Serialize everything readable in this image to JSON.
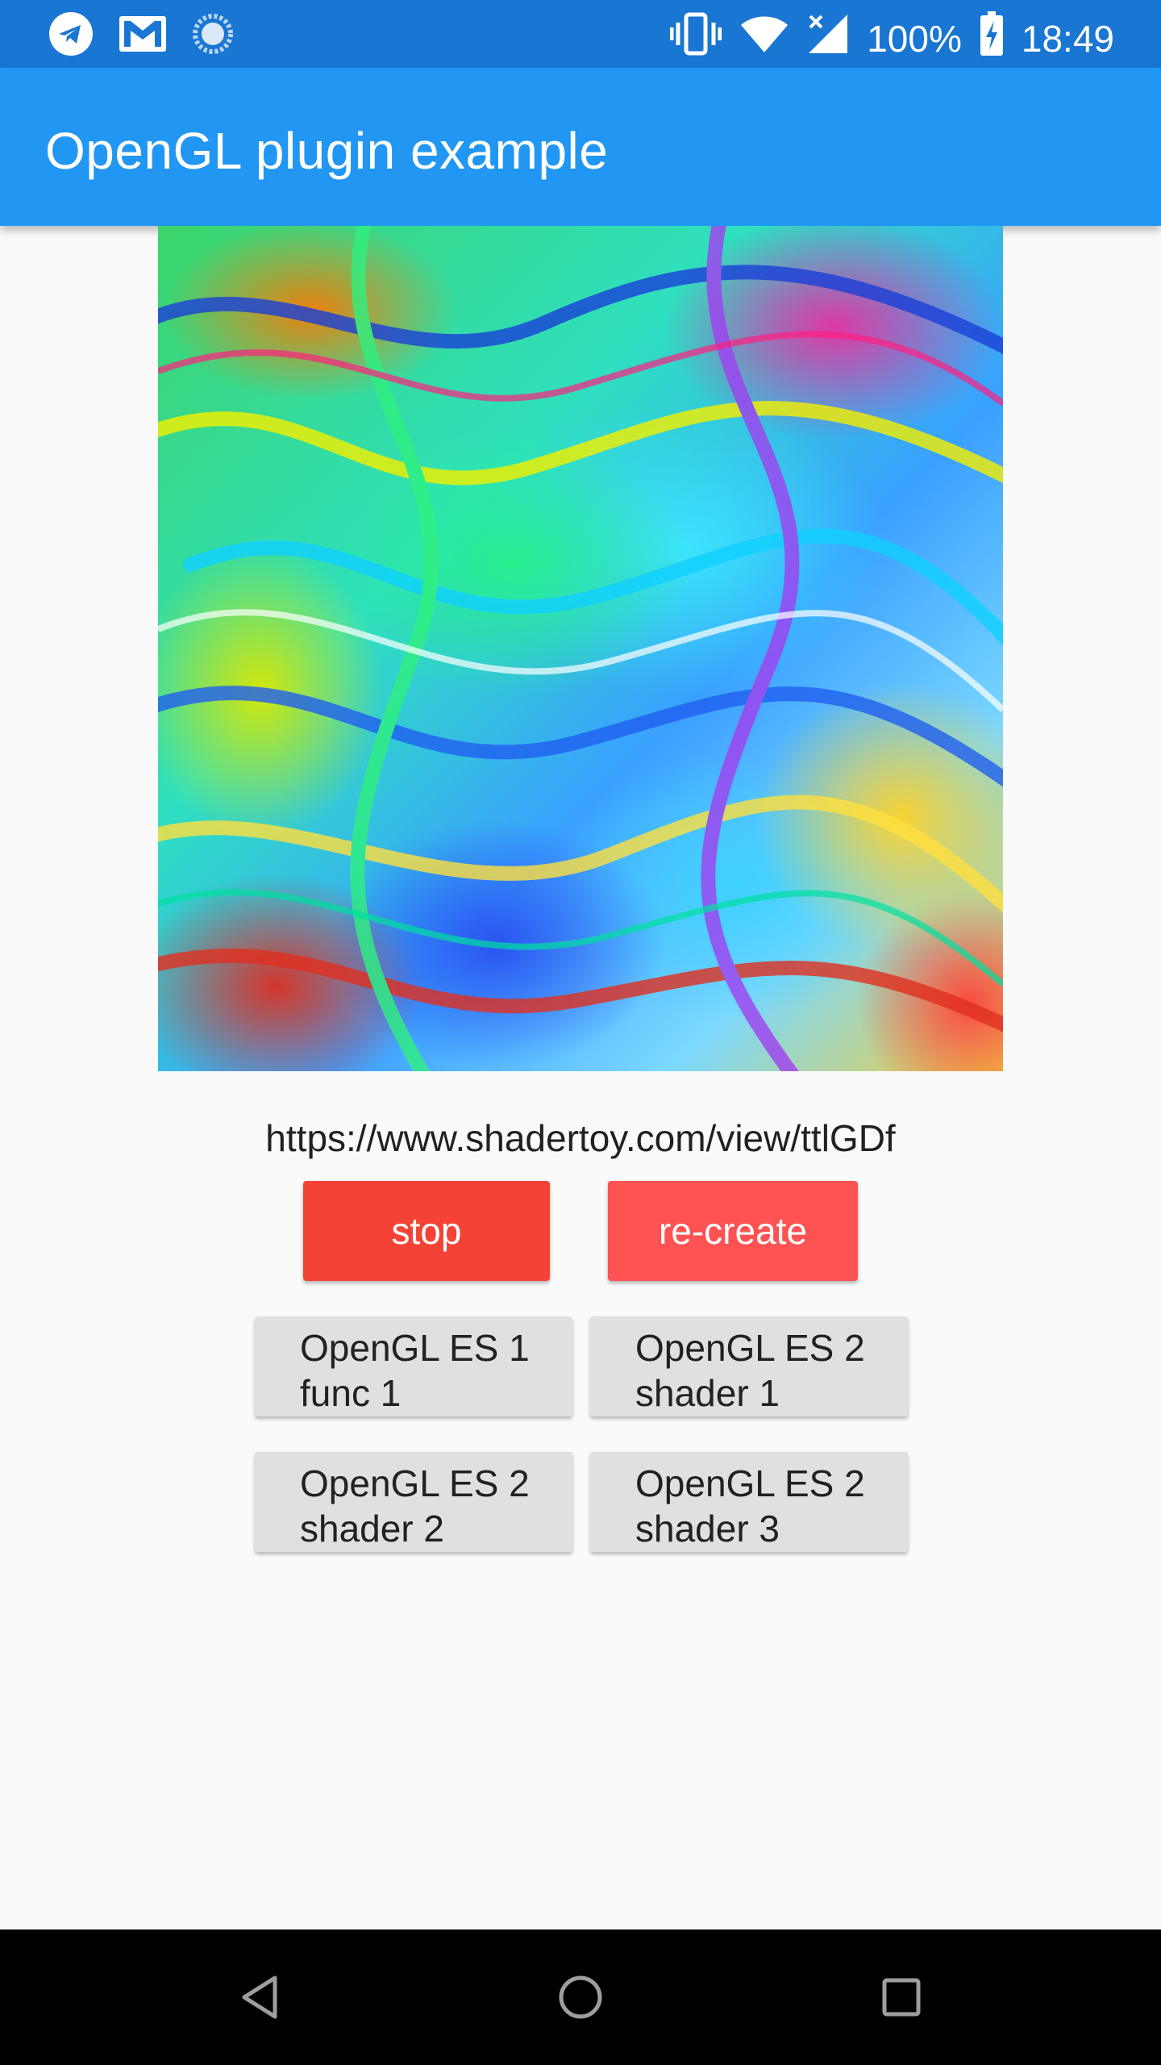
{
  "status_bar": {
    "battery": "100%",
    "time": "18:49",
    "icons": [
      "telegram-icon",
      "gmail-icon",
      "sync-icon",
      "vibrate-icon",
      "wifi-icon",
      "signal-icon",
      "battery-charging-icon"
    ]
  },
  "app_bar": {
    "title": "OpenGL plugin example"
  },
  "main": {
    "shader_url": "https://www.shadertoy.com/view/ttlGDf",
    "stop_label": "stop",
    "recreate_label": "re-create",
    "options": [
      {
        "line1": "OpenGL ES 1",
        "line2": "func 1"
      },
      {
        "line1": "OpenGL ES 2",
        "line2": "shader 1"
      },
      {
        "line1": "OpenGL ES 2",
        "line2": "shader 2"
      },
      {
        "line1": "OpenGL ES 2",
        "line2": "shader 3"
      }
    ]
  },
  "nav_bar": {
    "icons": [
      "back-icon",
      "home-icon",
      "recents-icon"
    ]
  },
  "colors": {
    "status_bar": "#1976d2",
    "app_bar": "#2196f3",
    "stop_button": "#f44336",
    "recreate_button": "#ff5252",
    "option_button": "#e0e0e0"
  }
}
